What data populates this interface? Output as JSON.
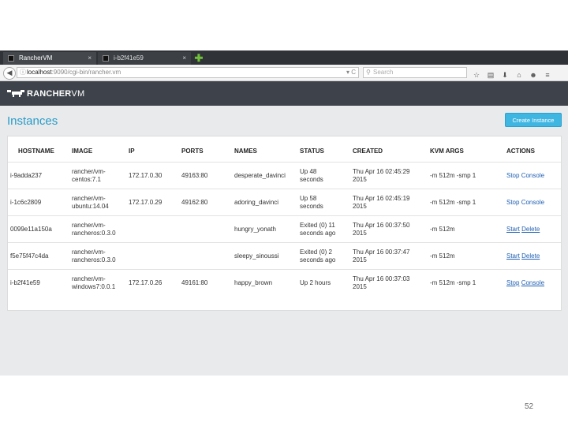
{
  "browser": {
    "tabs": [
      {
        "label": "RancherVM",
        "close": "×"
      },
      {
        "label": "i-b2f41e59",
        "close": "×"
      }
    ],
    "new_tab": "✚",
    "url_host": "localhost",
    "url_path": ":9090/cgi-bin/rancher.vm",
    "url_controls": "▾ C",
    "search_placeholder": "Search"
  },
  "app": {
    "logo_bold": "RANCHER",
    "logo_light": "VM"
  },
  "page": {
    "title": "Instances",
    "create_button": "Create Instance",
    "page_number": "52"
  },
  "table": {
    "headers": [
      "HOSTNAME",
      "IMAGE",
      "IP",
      "PORTS",
      "NAMES",
      "STATUS",
      "CREATED",
      "KVM ARGS",
      "ACTIONS"
    ],
    "rows": [
      {
        "hostname": "i-9adda237",
        "image": [
          "rancher/vm-",
          "centos:7.1"
        ],
        "ip": "172.17.0.30",
        "ports": "49163:80",
        "names": "desperate_davinci",
        "status": [
          "Up 48",
          "seconds"
        ],
        "created": [
          "Thu Apr 16 02:45:29",
          "2015"
        ],
        "kvm": "-m 512m -smp 1",
        "action1": "Stop",
        "action2": "Console"
      },
      {
        "hostname": "i-1c6c2809",
        "image": [
          "rancher/vm-",
          "ubuntu:14.04"
        ],
        "ip": "172.17.0.29",
        "ports": "49162:80",
        "names": "adoring_davinci",
        "status": [
          "Up 58",
          "seconds"
        ],
        "created": [
          "Thu Apr 16 02:45:19",
          "2015"
        ],
        "kvm": "-m 512m -smp 1",
        "action1": "Stop",
        "action2": "Console"
      },
      {
        "hostname": "0099e11a150a",
        "image": [
          "rancher/vm-",
          "rancheros:0.3.0"
        ],
        "ip": "",
        "ports": "",
        "names": "hungry_yonath",
        "status": [
          "Exited (0) 11",
          "seconds ago"
        ],
        "created": [
          "Thu Apr 16 00:37:50",
          "2015"
        ],
        "kvm": "-m 512m",
        "action1": "Start",
        "action2": "Delete"
      },
      {
        "hostname": "f5e75f47c4da",
        "image": [
          "rancher/vm-",
          "rancheros:0.3.0"
        ],
        "ip": "",
        "ports": "",
        "names": "sleepy_sinoussi",
        "status": [
          "Exited (0) 2",
          "seconds ago"
        ],
        "created": [
          "Thu Apr 16 00:37:47",
          "2015"
        ],
        "kvm": "-m 512m",
        "action1": "Start",
        "action2": "Delete"
      },
      {
        "hostname": "i-b2f41e59",
        "image": [
          "rancher/vm-",
          "windows7:0.0.1"
        ],
        "ip": "172.17.0.26",
        "ports": "49161:80",
        "names": "happy_brown",
        "status": [
          "Up 2 hours",
          ""
        ],
        "created": [
          "Thu Apr 16 00:37:03",
          "2015"
        ],
        "kvm": "-m 512m -smp 1",
        "action1": "Stop",
        "action2": "Console"
      }
    ]
  }
}
